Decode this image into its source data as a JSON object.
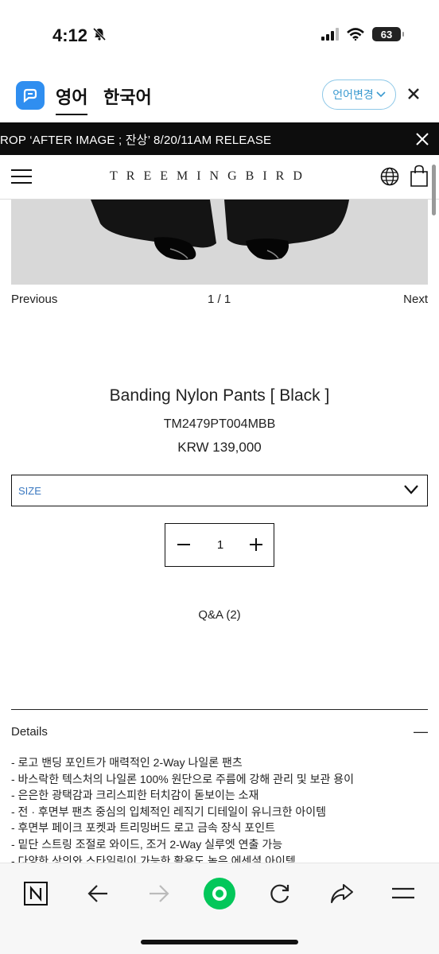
{
  "status_bar": {
    "time": "4:12",
    "battery": "63"
  },
  "translate_bar": {
    "lang_active": "영어",
    "lang_target": "한국어",
    "change_label": "언어변경"
  },
  "announcement": {
    "text": "ROP ‘AFTER IMAGE ; 잔상’ 8/20/11AM RELEASE"
  },
  "header": {
    "brand": "TREEMINGBIRD"
  },
  "gallery": {
    "prev_label": "Previous",
    "counter": "1 / 1",
    "next_label": "Next"
  },
  "product": {
    "title": "Banding Nylon Pants [ Black ]",
    "sku": "TM2479PT004MBB",
    "price": "KRW 139,000",
    "size_placeholder": "SIZE",
    "quantity": "1",
    "qa_label": "Q&A (2)"
  },
  "details": {
    "heading": "Details",
    "items": [
      "- 로고 밴딩 포인트가 매력적인 2-Way 나일론 팬츠",
      "- 바스락한 텍스처의 나일론 100% 원단으로 주름에 강해 관리 및 보관 용이",
      "- 은은한 광택감과 크리스피한 터치감이 돋보이는 소재",
      "- 전 · 후면부 팬츠 중심의 입체적인 레직기 디테일이 유니크한 아이템",
      "- 후면부 페이크 포켓과 트리밍버드 로고 금속 장식 포인트",
      "- 밑단 스트링 조절로 와이드, 조거 2-Way 실루엣 연출 가능",
      "- 다양한 상의와 스타일링이 가능한 활용도 높은 에센셜 아이템"
    ]
  },
  "colors": {
    "announce_bg": "#0d0d0d",
    "translate_accent": "#2f8ef0",
    "naver_green": "#03c75a"
  }
}
